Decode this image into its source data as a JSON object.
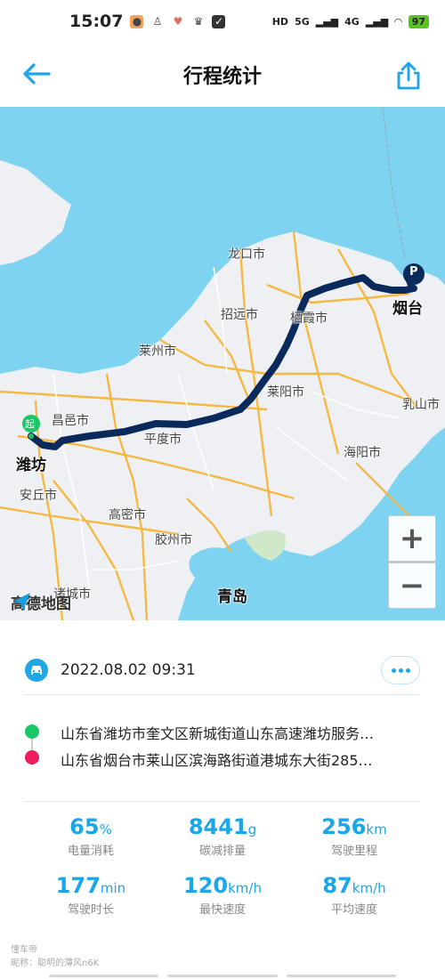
{
  "status_bar": {
    "time": "15:07",
    "network_1": "5G",
    "network_2": "4G",
    "hd_label": "HD",
    "battery": "97"
  },
  "header": {
    "title": "行程统计",
    "back_icon": "arrow-left-icon",
    "share_icon": "share-icon"
  },
  "map": {
    "start_badge": "起",
    "parking_badge": "P",
    "labels": {
      "longkou": "龙口市",
      "zhaoyuan": "招远市",
      "qixia": "栖霞市",
      "yantai": "烟台",
      "laizhou": "莱州市",
      "laiyang": "莱阳市",
      "rushan": "乳山市",
      "changyi": "昌邑市",
      "pingdu": "平度市",
      "weifang": "潍坊",
      "anqiu": "安丘市",
      "haiyang": "海阳市",
      "gaomi": "高密市",
      "jiaozhou": "胶州市",
      "qingdao": "青岛",
      "zhucheng": "诸城市"
    },
    "logo_text": "高德地图",
    "zoom_in": "+",
    "zoom_out": "−",
    "colors": {
      "sea": "#7dd3f0",
      "land": "#eef0f4",
      "route": "#0b2a5c",
      "highway": "#f5b942"
    }
  },
  "trip": {
    "datetime": "2022.08.02 09:31",
    "start_address": "山东省潍坊市奎文区新城街道山东高速潍坊服务…",
    "end_address": "山东省烟台市莱山区滨海路街道港城东大街285…"
  },
  "stats": [
    {
      "value": "65",
      "unit": "%",
      "label": "电量消耗"
    },
    {
      "value": "8441",
      "unit": "g",
      "label": "碳减排量"
    },
    {
      "value": "256",
      "unit": "km",
      "label": "驾驶里程"
    },
    {
      "value": "177",
      "unit": "min",
      "label": "驾驶时长"
    },
    {
      "value": "120",
      "unit": "km/h",
      "label": "最快速度"
    },
    {
      "value": "87",
      "unit": "km/h",
      "label": "平均速度"
    }
  ],
  "watermark": {
    "line1": "懂车帝",
    "line2": "昵称：聪明的薄风n6K"
  },
  "accent_color": "#1aa6e8"
}
